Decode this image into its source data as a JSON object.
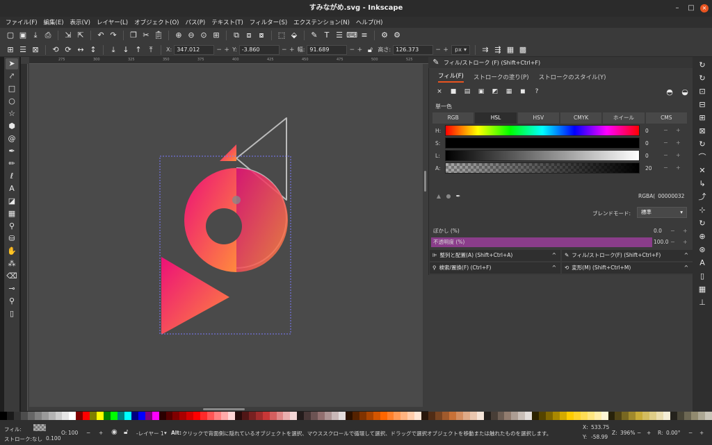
{
  "window": {
    "title": "すみながめ.svg - Inkscape",
    "minimize": "–",
    "maximize": "□",
    "close": "×"
  },
  "menu": [
    "ファイル(F)",
    "編集(E)",
    "表示(V)",
    "レイヤー(L)",
    "オブジェクト(O)",
    "パス(P)",
    "テキスト(T)",
    "フィルター(S)",
    "エクステンション(N)",
    "ヘルプ(H)"
  ],
  "controls": {
    "x_label": "X:",
    "x_value": "347.012",
    "y_label": "Y:",
    "y_value": "-3.860",
    "w_label": "幅:",
    "w_value": "91.689",
    "h_label": "高さ:",
    "h_value": "126.373",
    "unit": "px",
    "minus": "−",
    "plus": "+"
  },
  "ruler": {
    "ticks": [
      "275",
      "300",
      "325",
      "350",
      "375",
      "400",
      "425",
      "450",
      "475",
      "500",
      "525"
    ]
  },
  "panel": {
    "title": "フィル/ストローク (F) (Shift+Ctrl+F)",
    "tabs": [
      "フィル(F)",
      "ストロークの塗り(P)",
      "ストロークのスタイル(Y)"
    ],
    "fill_buttons": [
      "×",
      "■",
      "▤",
      "▣",
      "◩",
      "▦",
      "◼",
      "?"
    ],
    "flat_color": "単一色",
    "modes": [
      "RGB",
      "HSL",
      "HSV",
      "CMYK",
      "ホイール",
      "CMS"
    ],
    "active_mode": "HSL",
    "sliders": [
      {
        "label": "H:",
        "value": "0"
      },
      {
        "label": "S:",
        "value": "0"
      },
      {
        "label": "L:",
        "value": "0"
      },
      {
        "label": "A:",
        "value": "20"
      }
    ],
    "rgba_label": "RGBA(",
    "rgba_value": "00000032",
    "blend_label": "ブレンドモード:",
    "blend_value": "標準",
    "blur_label": "ぼかし (%)",
    "blur_value": "0.0",
    "opacity_label": "不透明度 (%)",
    "opacity_value": "100.0",
    "opacity_fill": 1.0
  },
  "docked": [
    {
      "label": "整列と配置(A) (Shift+Ctrl+A)",
      "arrow": "^"
    },
    {
      "label": "フィル/ストローク(F) (Shift+Ctrl+F)",
      "arrow": "^"
    },
    {
      "label": "検索/置換(F) (Ctrl+F)",
      "arrow": "^"
    },
    {
      "label": "変形(M) (Shift+Ctrl+M)",
      "arrow": "^"
    }
  ],
  "status": {
    "fill_label": "フィル:",
    "stroke_label": "ストローク:",
    "stroke_value": "なし",
    "stroke_width": "0.100",
    "opacity_label": "O:",
    "opacity_value": "100",
    "layer": "-レイヤー 1",
    "message_prefix": "Alt:",
    "message": "クリックで背面側に隠れているオブジェクトを選択、マウススクロールで循環して選択、ドラッグで選択オブジェクトを移動または触れたものを選択します。",
    "x_label": "X:",
    "x_value": "533.75",
    "y_label": "Y:",
    "y_value": "-58.99",
    "zoom_label": "Z:",
    "zoom_value": "396%",
    "rotate_label": "R:",
    "rotate_value": "0.00°"
  },
  "colors": {
    "accent": "#e95420",
    "gradient_start": "#ec0f78",
    "gradient_end": "#ff8a3d",
    "opacity_bar": "#8a3d8a"
  },
  "palette": [
    "#000000",
    "#1a1a1a",
    "#333333",
    "#4d4d4d",
    "#666666",
    "#808080",
    "#999999",
    "#b3b3b3",
    "#cccccc",
    "#e6e6e6",
    "#ffffff",
    "#800000",
    "#ff0000",
    "#808000",
    "#ffff00",
    "#008000",
    "#00ff00",
    "#008080",
    "#00ffff",
    "#000080",
    "#0000ff",
    "#800080",
    "#ff00ff",
    "#2b0000",
    "#550000",
    "#800000",
    "#aa0000",
    "#d40000",
    "#ff0000",
    "#ff2a2a",
    "#ff5555",
    "#ff8080",
    "#ffaaaa",
    "#ffd5d5",
    "#280b0b",
    "#501616",
    "#782121",
    "#a02c2c",
    "#c83737",
    "#d35f5f",
    "#de8787",
    "#e9afaf",
    "#f4d7d7",
    "#241c1c",
    "#483737",
    "#6c5353",
    "#916f6f",
    "#ac9393",
    "#c8b7b7",
    "#e3dbdb",
    "#2b1100",
    "#552200",
    "#803300",
    "#aa4400",
    "#d45500",
    "#ff6600",
    "#ff7f2a",
    "#ff9955",
    "#ffb380",
    "#ffccaa",
    "#ffe6d5",
    "#28170b",
    "#502d16",
    "#784421",
    "#a05a2c",
    "#c87137",
    "#d38d5f",
    "#deaa87",
    "#e9c6af",
    "#f4e3d7",
    "#241f1c",
    "#483e37",
    "#6c5d53",
    "#917c6f",
    "#ac9d93",
    "#c8beb7",
    "#e3dedb",
    "#2b2200",
    "#554400",
    "#806600",
    "#aa8800",
    "#d4aa00",
    "#ffcc00",
    "#ffd42a",
    "#ffdd55",
    "#ffe680",
    "#ffeeaa",
    "#fff6d5",
    "#28220b",
    "#504416",
    "#786721",
    "#a0892c",
    "#c8ab37",
    "#d3bc5f",
    "#decd87",
    "#e9ddaf",
    "#f4eed7",
    "#24221c",
    "#484537",
    "#6c6753",
    "#918a6f",
    "#aca793",
    "#c8c4b7"
  ]
}
